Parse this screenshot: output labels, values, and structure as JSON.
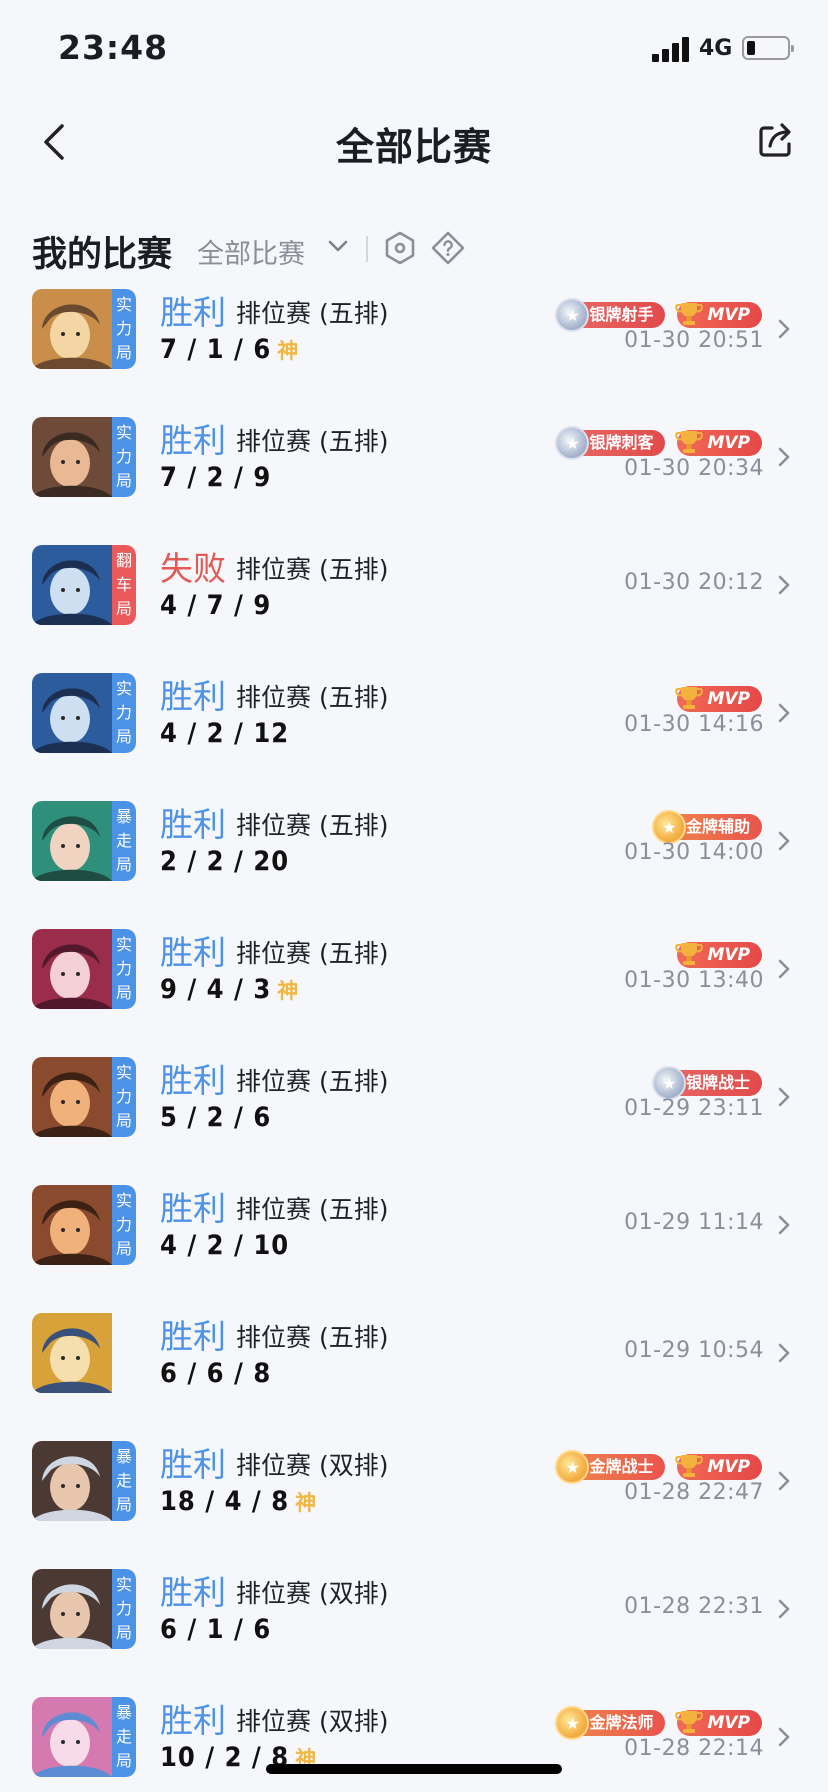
{
  "status_bar": {
    "time": "23:48",
    "network": "4G",
    "battery_level": 0.15
  },
  "nav": {
    "title": "全部比赛"
  },
  "section": {
    "title": "我的比赛",
    "filter_label": "全部比赛"
  },
  "matches": [
    {
      "tag": "实力局",
      "tag_color": "#4c92e6",
      "result": "胜利",
      "mode": "排位赛 (五排)",
      "kda": "7 / 1 / 6",
      "god": "神",
      "badges": [
        {
          "kind": "silver",
          "label": "银牌射手"
        },
        {
          "kind": "mvp",
          "label": "MVP"
        }
      ],
      "time": "01-30 20:51",
      "portrait": [
        "#c98f4a",
        "#f3d6a3",
        "#6b4a2f"
      ]
    },
    {
      "tag": "实力局",
      "tag_color": "#4c92e6",
      "result": "胜利",
      "mode": "排位赛 (五排)",
      "kda": "7 / 2 / 9",
      "god": "",
      "badges": [
        {
          "kind": "silver",
          "label": "银牌刺客"
        },
        {
          "kind": "mvp",
          "label": "MVP"
        }
      ],
      "time": "01-30 20:34",
      "portrait": [
        "#6e4b39",
        "#e9b995",
        "#3a2a22"
      ]
    },
    {
      "tag": "翻车局",
      "tag_color": "#ea5a5a",
      "result": "失败",
      "mode": "排位赛 (五排)",
      "kda": "4 / 7 / 9",
      "god": "",
      "badges": [],
      "time": "01-30 20:12",
      "portrait": [
        "#2d5c9c",
        "#cfdff2",
        "#1b2f52"
      ]
    },
    {
      "tag": "实力局",
      "tag_color": "#4c92e6",
      "result": "胜利",
      "mode": "排位赛 (五排)",
      "kda": "4 / 2 / 12",
      "god": "",
      "badges": [
        {
          "kind": "mvp",
          "label": "MVP"
        }
      ],
      "time": "01-30 14:16",
      "portrait": [
        "#2d5c9c",
        "#cfdff2",
        "#1b2f52"
      ]
    },
    {
      "tag": "暴走局",
      "tag_color": "#4c92e6",
      "result": "胜利",
      "mode": "排位赛 (五排)",
      "kda": "2 / 2 / 20",
      "god": "",
      "badges": [
        {
          "kind": "gold",
          "label": "金牌辅助"
        }
      ],
      "time": "01-30 14:00",
      "portrait": [
        "#2e8f7a",
        "#f1d3c1",
        "#1f4d44"
      ]
    },
    {
      "tag": "实力局",
      "tag_color": "#4c92e6",
      "result": "胜利",
      "mode": "排位赛 (五排)",
      "kda": "9 / 4 / 3",
      "god": "神",
      "badges": [
        {
          "kind": "mvp",
          "label": "MVP"
        }
      ],
      "time": "01-30 13:40",
      "portrait": [
        "#9a2d4a",
        "#f5cfd6",
        "#52182b"
      ]
    },
    {
      "tag": "实力局",
      "tag_color": "#4c92e6",
      "result": "胜利",
      "mode": "排位赛 (五排)",
      "kda": "5 / 2 / 6",
      "god": "",
      "badges": [
        {
          "kind": "silver",
          "label": "银牌战士"
        }
      ],
      "time": "01-29 23:11",
      "portrait": [
        "#8a4a2e",
        "#f0b27a",
        "#3b2215"
      ]
    },
    {
      "tag": "实力局",
      "tag_color": "#4c92e6",
      "result": "胜利",
      "mode": "排位赛 (五排)",
      "kda": "4 / 2 / 10",
      "god": "",
      "badges": [],
      "time": "01-29 11:14",
      "portrait": [
        "#8a4a2e",
        "#f0b27a",
        "#3b2215"
      ]
    },
    {
      "tag": "",
      "tag_color": "",
      "result": "胜利",
      "mode": "排位赛 (五排)",
      "kda": "6 / 6 / 8",
      "god": "",
      "badges": [],
      "time": "01-29 10:54",
      "portrait": [
        "#d8a23a",
        "#f6dfae",
        "#38507a"
      ]
    },
    {
      "tag": "暴走局",
      "tag_color": "#4c92e6",
      "result": "胜利",
      "mode": "排位赛 (双排)",
      "kda": "18 / 4 / 8",
      "god": "神",
      "badges": [
        {
          "kind": "gold",
          "label": "金牌战士"
        },
        {
          "kind": "mvp",
          "label": "MVP"
        }
      ],
      "time": "01-28 22:47",
      "portrait": [
        "#4a3a33",
        "#e7c6ad",
        "#cfd6e2"
      ]
    },
    {
      "tag": "实力局",
      "tag_color": "#4c92e6",
      "result": "胜利",
      "mode": "排位赛 (双排)",
      "kda": "6 / 1 / 6",
      "god": "",
      "badges": [],
      "time": "01-28 22:31",
      "portrait": [
        "#4a3a33",
        "#e7c6ad",
        "#cfd6e2"
      ]
    },
    {
      "tag": "暴走局",
      "tag_color": "#4c92e6",
      "result": "胜利",
      "mode": "排位赛 (双排)",
      "kda": "10 / 2 / 8",
      "god": "神",
      "badges": [
        {
          "kind": "gold",
          "label": "金牌法师"
        },
        {
          "kind": "mvp",
          "label": "MVP"
        }
      ],
      "time": "01-28 22:14",
      "portrait": [
        "#d47ab0",
        "#f8dbe9",
        "#5d8bd4"
      ]
    }
  ]
}
